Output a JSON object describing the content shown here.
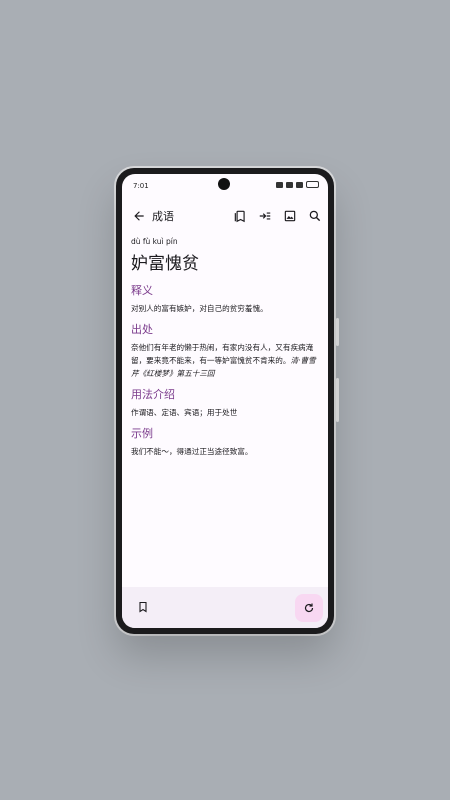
{
  "status": {
    "time": "7:01"
  },
  "appbar": {
    "title": "成语"
  },
  "entry": {
    "pinyin": "dù fù kuì pín",
    "idiom": "妒富愧贫",
    "sections": [
      {
        "title": "释义",
        "text": "对别人的富有嫉妒，对自己的贫穷羞愧。"
      },
      {
        "title": "出处",
        "text": "奈他们有年老的懒于热闹，有家内没有人，又有疾病淹留，要来竟不能来，有一等妒富愧贫不肯来的。",
        "source": "清·曹雪芹《红楼梦》第五十三回"
      },
      {
        "title": "用法介绍",
        "text": "作谓语、定语、宾语；用于处世"
      },
      {
        "title": "示例",
        "text": "我们不能～，得通过正当途径致富。"
      }
    ]
  },
  "icons": {
    "back": "arrow-back-icon",
    "collections": "bookmarks-icon",
    "jump": "format-indent-icon",
    "image": "image-icon",
    "search": "search-icon",
    "bookmark": "bookmark-icon",
    "refresh": "refresh-icon"
  },
  "colors": {
    "accent": "#7b3b8c",
    "fab_bg": "#f8d8f2",
    "bottombar_bg": "#f4eef7",
    "backdrop": "#a9aeb4"
  }
}
